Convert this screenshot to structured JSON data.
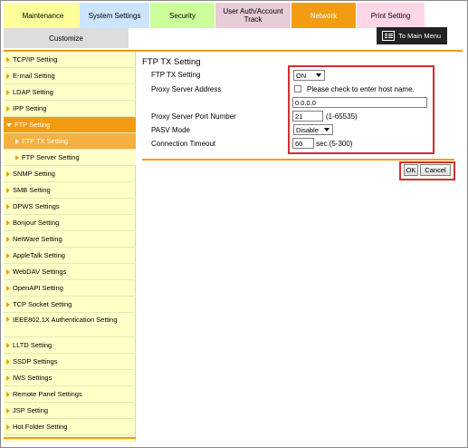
{
  "tabs": [
    {
      "label": "Maintenance",
      "color": "#ffff99"
    },
    {
      "label": "System Settings",
      "color": "#cce5ff"
    },
    {
      "label": "Security",
      "color": "#ccff99"
    },
    {
      "label": "User Auth/Account Track",
      "color": "#e8ccd8"
    },
    {
      "label": "Network",
      "color": "#f39c12"
    },
    {
      "label": "Print Setting",
      "color": "#ffd6e7"
    }
  ],
  "sub_tab": {
    "label": "Customize"
  },
  "main_menu": {
    "label": "To Main Menu"
  },
  "sidebar": {
    "items": [
      "TCP/IP Setting",
      "E-mail Setting",
      "LDAP Setting",
      "IPP Setting",
      "FTP Setting",
      "FTP TX Setting",
      "FTP Server Setting",
      "SNMP Setting",
      "SMB Setting",
      "DPWS Settings",
      "Bonjour Setting",
      "NetWare Setting",
      "AppleTalk Setting",
      "WebDAV Settings",
      "OpenAPI Setting",
      "TCP Socket Setting",
      "IEEE802.1X Authentication Setting",
      "LLTD Setting",
      "SSDP Settings",
      "IWS Settings",
      "Remote Panel Settings",
      "JSP Setting",
      "Hot Folder Setting"
    ]
  },
  "main": {
    "title": "FTP TX Setting",
    "labels": {
      "ftp_tx": "FTP TX Setting",
      "proxy_address": "Proxy Server Address",
      "proxy_port": "Proxy Server Port Number",
      "pasv": "PASV Mode",
      "timeout": "Connection Timeout"
    },
    "ftp_tx_value": "ON",
    "host_checkbox_label": "Please check to enter host name.",
    "proxy_address_value": "0.0.0.0",
    "proxy_port_value": "21",
    "proxy_port_range": "(1-65535)",
    "pasv_value": "Disable",
    "timeout_value": "60",
    "timeout_range": "sec.(5-300)",
    "ok_label": "OK",
    "cancel_label": "Cancel"
  },
  "colors": {
    "accent": "#f39c12",
    "sidebar_bg": "#ffffc8",
    "highlight_red": "#d32f2f"
  }
}
